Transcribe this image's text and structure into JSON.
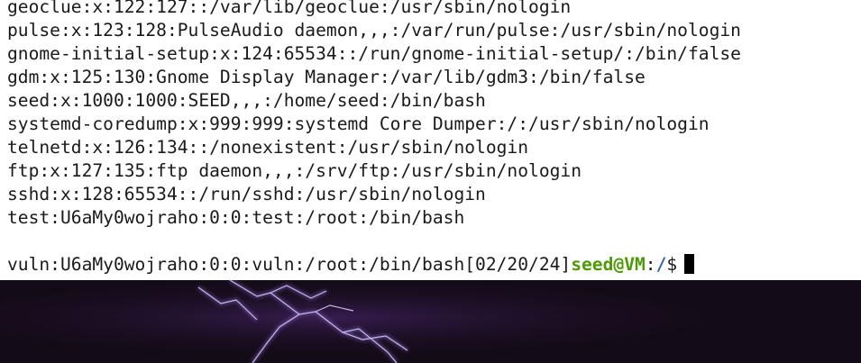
{
  "terminal": {
    "lines": [
      "geoclue:x:122:127::/var/lib/geoclue:/usr/sbin/nologin",
      "pulse:x:123:128:PulseAudio daemon,,,:/var/run/pulse:/usr/sbin/nologin",
      "gnome-initial-setup:x:124:65534::/run/gnome-initial-setup/:/bin/false",
      "gdm:x:125:130:Gnome Display Manager:/var/lib/gdm3:/bin/false",
      "seed:x:1000:1000:SEED,,,:/home/seed:/bin/bash",
      "systemd-coredump:x:999:999:systemd Core Dumper:/:/usr/sbin/nologin",
      "telnetd:x:126:134::/nonexistent:/usr/sbin/nologin",
      "ftp:x:127:135:ftp daemon,,,:/srv/ftp:/usr/sbin/nologin",
      "sshd:x:128:65534::/run/sshd:/usr/sbin/nologin",
      "test:U6aMy0wojraho:0:0:test:/root:/bin/bash",
      "",
      "vuln:U6aMy0wojraho:0:0:vuln:/root:/bin/bash[02/20/24]"
    ],
    "prompt": {
      "user_host": "seed@VM",
      "separator": ":",
      "path": "/",
      "symbol": "$"
    }
  },
  "colors": {
    "text": "#1a1a1a",
    "prompt_user": "#4e9a06",
    "prompt_path": "#3465a4",
    "desktop_bg": "#140b18",
    "lightning": "#a58ad6"
  },
  "desktop": {
    "wallpaper": "purple-lightning"
  }
}
